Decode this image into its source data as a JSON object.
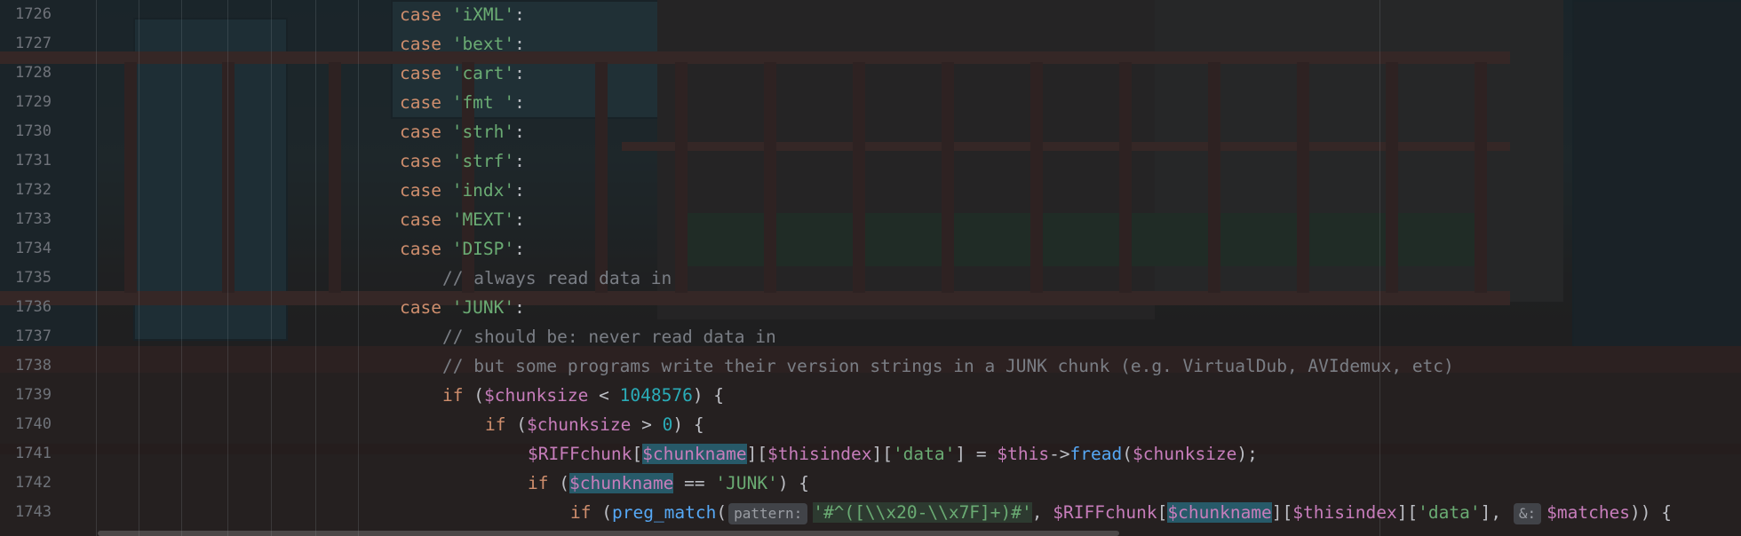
{
  "editor": {
    "lines": [
      {
        "num": "1726",
        "tokens": [
          [
            "kw",
            "case "
          ],
          [
            "str",
            "'iXML'"
          ],
          [
            "p",
            ":"
          ]
        ]
      },
      {
        "num": "1727",
        "tokens": [
          [
            "kw",
            "case "
          ],
          [
            "str",
            "'bext'"
          ],
          [
            "p",
            ":"
          ]
        ]
      },
      {
        "num": "1728",
        "tokens": [
          [
            "kw",
            "case "
          ],
          [
            "str",
            "'cart'"
          ],
          [
            "p",
            ":"
          ]
        ]
      },
      {
        "num": "1729",
        "tokens": [
          [
            "kw",
            "case "
          ],
          [
            "str",
            "'fmt '"
          ],
          [
            "p",
            ":"
          ]
        ]
      },
      {
        "num": "1730",
        "tokens": [
          [
            "kw",
            "case "
          ],
          [
            "str",
            "'strh'"
          ],
          [
            "p",
            ":"
          ]
        ]
      },
      {
        "num": "1731",
        "tokens": [
          [
            "kw",
            "case "
          ],
          [
            "str",
            "'strf'"
          ],
          [
            "p",
            ":"
          ]
        ]
      },
      {
        "num": "1732",
        "tokens": [
          [
            "kw",
            "case "
          ],
          [
            "str",
            "'indx'"
          ],
          [
            "p",
            ":"
          ]
        ]
      },
      {
        "num": "1733",
        "tokens": [
          [
            "kw",
            "case "
          ],
          [
            "str",
            "'MEXT'"
          ],
          [
            "p",
            ":"
          ]
        ]
      },
      {
        "num": "1734",
        "tokens": [
          [
            "kw",
            "case "
          ],
          [
            "str",
            "'DISP'"
          ],
          [
            "p",
            ":"
          ]
        ]
      },
      {
        "num": "1735",
        "indent": 1,
        "tokens": [
          [
            "cmt",
            "// always read data in"
          ]
        ]
      },
      {
        "num": "1736",
        "tokens": [
          [
            "kw",
            "case "
          ],
          [
            "str",
            "'JUNK'"
          ],
          [
            "p",
            ":"
          ]
        ]
      },
      {
        "num": "1737",
        "indent": 1,
        "tokens": [
          [
            "cmt",
            "// should be: never read data in"
          ]
        ]
      },
      {
        "num": "1738",
        "indent": 1,
        "tokens": [
          [
            "cmt",
            "// but some programs write their version strings in a JUNK chunk (e.g. VirtualDub, AVIdemux, etc)"
          ]
        ]
      },
      {
        "num": "1739",
        "indent": 1,
        "tokens": [
          [
            "kw",
            "if "
          ],
          [
            "p",
            "("
          ],
          [
            "var",
            "$chunksize"
          ],
          [
            "p",
            " < "
          ],
          [
            "num",
            "1048576"
          ],
          [
            "p",
            ") {"
          ]
        ]
      },
      {
        "num": "1740",
        "indent": 2,
        "tokens": [
          [
            "kw",
            "if "
          ],
          [
            "p",
            "("
          ],
          [
            "var",
            "$chunksize"
          ],
          [
            "p",
            " > "
          ],
          [
            "num",
            "0"
          ],
          [
            "p",
            ") {"
          ]
        ]
      },
      {
        "num": "1741",
        "indent": 3,
        "tokens": [
          [
            "var",
            "$RIFFchunk"
          ],
          [
            "p",
            "["
          ],
          [
            "hl",
            "$chunkname"
          ],
          [
            "p",
            "]["
          ],
          [
            "var",
            "$thisindex"
          ],
          [
            "p",
            "]["
          ],
          [
            "str",
            "'data'"
          ],
          [
            "p",
            "] = "
          ],
          [
            "var",
            "$this"
          ],
          [
            "p",
            "->"
          ],
          [
            "fn",
            "fread"
          ],
          [
            "p",
            "("
          ],
          [
            "var",
            "$chunksize"
          ],
          [
            "p",
            ");"
          ]
        ]
      },
      {
        "num": "1742",
        "indent": 3,
        "tokens": [
          [
            "kw",
            "if "
          ],
          [
            "p",
            "("
          ],
          [
            "hl",
            "$chunkname"
          ],
          [
            "p",
            " == "
          ],
          [
            "str",
            "'JUNK'"
          ],
          [
            "p",
            ") {"
          ]
        ]
      },
      {
        "num": "1743",
        "indent": 4,
        "tokens": [
          [
            "kw",
            "if "
          ],
          [
            "p",
            "("
          ],
          [
            "fn",
            "preg_match"
          ],
          [
            "p",
            "("
          ],
          [
            "hint",
            "pattern:"
          ],
          [
            "rxs",
            "'#^([\\\\x20-\\\\x7F]+)#'"
          ],
          [
            "p",
            ", "
          ],
          [
            "var",
            "$RIFFchunk"
          ],
          [
            "p",
            "["
          ],
          [
            "hl",
            "$chunkname"
          ],
          [
            "p",
            "]["
          ],
          [
            "var",
            "$thisindex"
          ],
          [
            "p",
            "]["
          ],
          [
            "str",
            "'data'"
          ],
          [
            "p",
            "], "
          ],
          [
            "hint",
            "&:"
          ],
          [
            "var",
            "$matches"
          ],
          [
            "p",
            ")) {"
          ]
        ]
      }
    ]
  }
}
